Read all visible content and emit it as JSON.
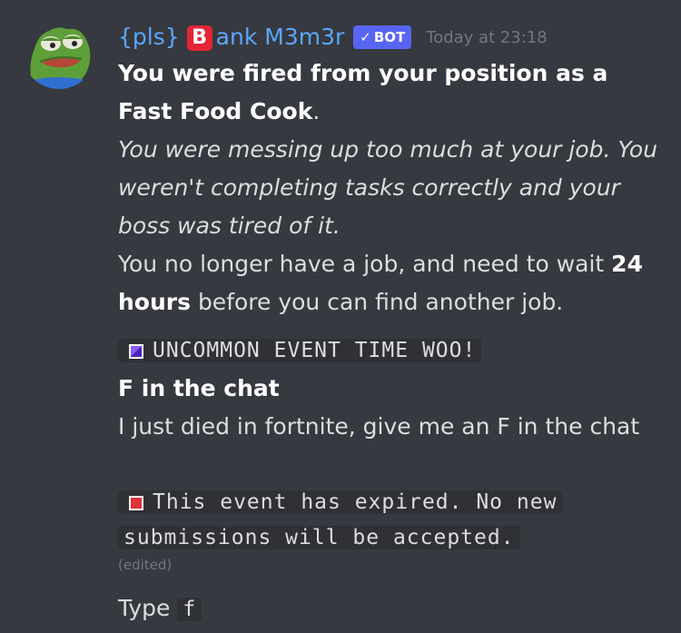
{
  "message": {
    "author": {
      "name": "{pls}",
      "name_suffix": "ank M3m3r",
      "emoji_letter": "B",
      "bot_tag": "BOT",
      "avatar_icon": "pepe-frog-avatar"
    },
    "timestamp": "Today at 23:18",
    "fired_bold": "You were fired from your position as a Fast Food Cook",
    "fired_period": ".",
    "reason": "You were messing up too much at your job. You weren't completing tasks correctly and your boss was tired of it.",
    "wait_pre": "You no longer have a job, and need to wait",
    "wait_bold": "24 hours",
    "wait_post": "before you can find another job.",
    "event_label": "UNCOMMON EVENT TIME WOO!",
    "event_title": "F in the chat",
    "event_text": "I just died in fortnite, give me an F in the chat",
    "expired_line1": "This event has expired. No new",
    "expired_line2": "submissions will be accepted.",
    "edited": "(edited)",
    "type_label": "Type",
    "type_code": "f"
  },
  "colors": {
    "background": "#36393f",
    "username": "#5aa6ff",
    "bot_tag": "#5865f2",
    "timestamp": "#72767d",
    "uncommon_square": "#6b3fd8",
    "expired_square": "#e0303a"
  }
}
